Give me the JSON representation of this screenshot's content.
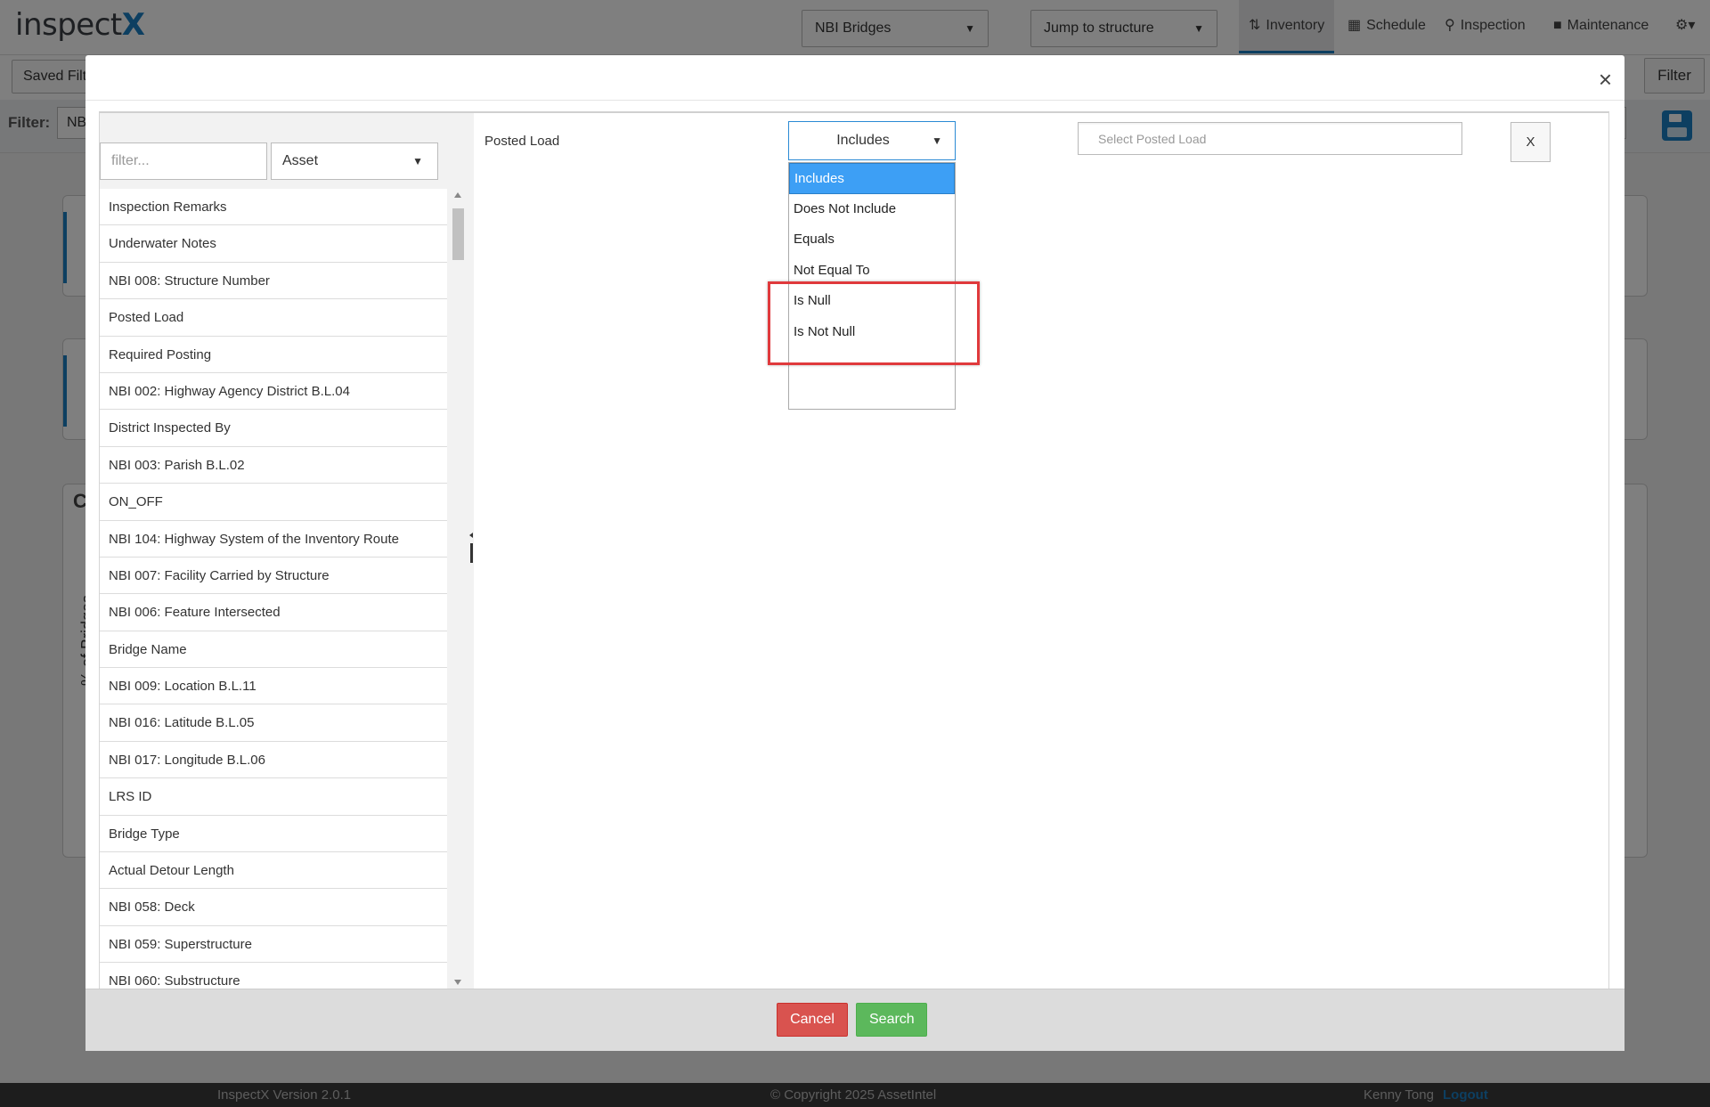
{
  "app": {
    "logo_main": "inspect",
    "logo_accent": "X",
    "asset_type_select": "NBI Bridges",
    "jump_select": "Jump to structure",
    "nav": [
      {
        "label": "Inventory",
        "icon": "sort-icon"
      },
      {
        "label": "Schedule",
        "icon": "calendar-icon"
      },
      {
        "label": "Inspection",
        "icon": "search-icon"
      },
      {
        "label": "Maintenance",
        "icon": "briefcase-icon"
      }
    ],
    "saved_filters": "Saved Filte",
    "filter_button": "Filter",
    "filter_label": "Filter:",
    "filter_chip": "NB",
    "chart_letter": "C",
    "chart_ylabel": "% of Bridges"
  },
  "modal": {
    "close_glyph": "×",
    "filter_placeholder": "filter...",
    "category_select": "Asset",
    "fields": [
      "Inspection Remarks",
      "Underwater Notes",
      "NBI 008: Structure Number",
      "Posted Load",
      "Required Posting",
      "NBI 002: Highway Agency District B.L.04",
      "District Inspected By",
      "NBI 003: Parish B.L.02",
      "ON_OFF",
      "NBI 104: Highway System of the Inventory Route",
      "NBI 007: Facility Carried by Structure",
      "NBI 006: Feature Intersected",
      "Bridge Name",
      "NBI 009: Location B.L.11",
      "NBI 016: Latitude B.L.05",
      "NBI 017: Longitude B.L.06",
      "LRS ID",
      "Bridge Type",
      "Actual Detour Length",
      "NBI 058: Deck",
      "NBI 059: Superstructure",
      "NBI 060: Substructure"
    ],
    "criterion": {
      "field_label": "Posted Load",
      "operator": "Includes",
      "operators": [
        "Includes",
        "Does Not Include",
        "Equals",
        "Not Equal To",
        "Is Null",
        "Is Not Null"
      ],
      "selected_operator": "Includes",
      "value_placeholder": "Select Posted Load",
      "remove_label": "X"
    },
    "cancel_label": "Cancel",
    "search_label": "Search"
  },
  "footer": {
    "version": "InspectX Version 2.0.1",
    "copyright": "© Copyright 2025 AssetIntel",
    "user": "Kenny Tong",
    "logout": "Logout"
  },
  "colors": {
    "brand": "#1b7ec2",
    "highlight": "#e0393c",
    "selected_option": "#3d9ff5",
    "cancel": "#d9534f",
    "search": "#5cb85c"
  }
}
